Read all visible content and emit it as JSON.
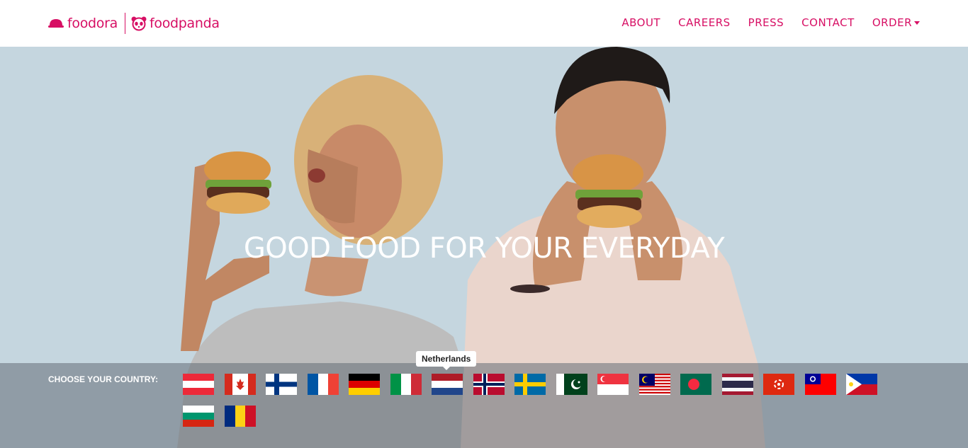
{
  "brand": {
    "name_1": "foodora",
    "name_2": "foodpanda",
    "color": "#d70f64"
  },
  "nav": {
    "items": [
      {
        "label": "ABOUT"
      },
      {
        "label": "CAREERS"
      },
      {
        "label": "PRESS"
      },
      {
        "label": "CONTACT"
      },
      {
        "label": "ORDER"
      }
    ]
  },
  "hero": {
    "headline": "GOOD FOOD FOR YOUR EVERYDAY"
  },
  "countries": {
    "label": "CHOOSE YOUR COUNTRY:",
    "tooltip": "Netherlands",
    "flags": [
      "Austria",
      "Canada",
      "Finland",
      "France",
      "Germany",
      "Italy",
      "Netherlands",
      "Norway",
      "Sweden",
      "Pakistan",
      "Singapore",
      "Malaysia",
      "Bangladesh",
      "Thailand",
      "Hong Kong",
      "Taiwan",
      "Philippines",
      "Bulgaria",
      "Romania"
    ]
  }
}
